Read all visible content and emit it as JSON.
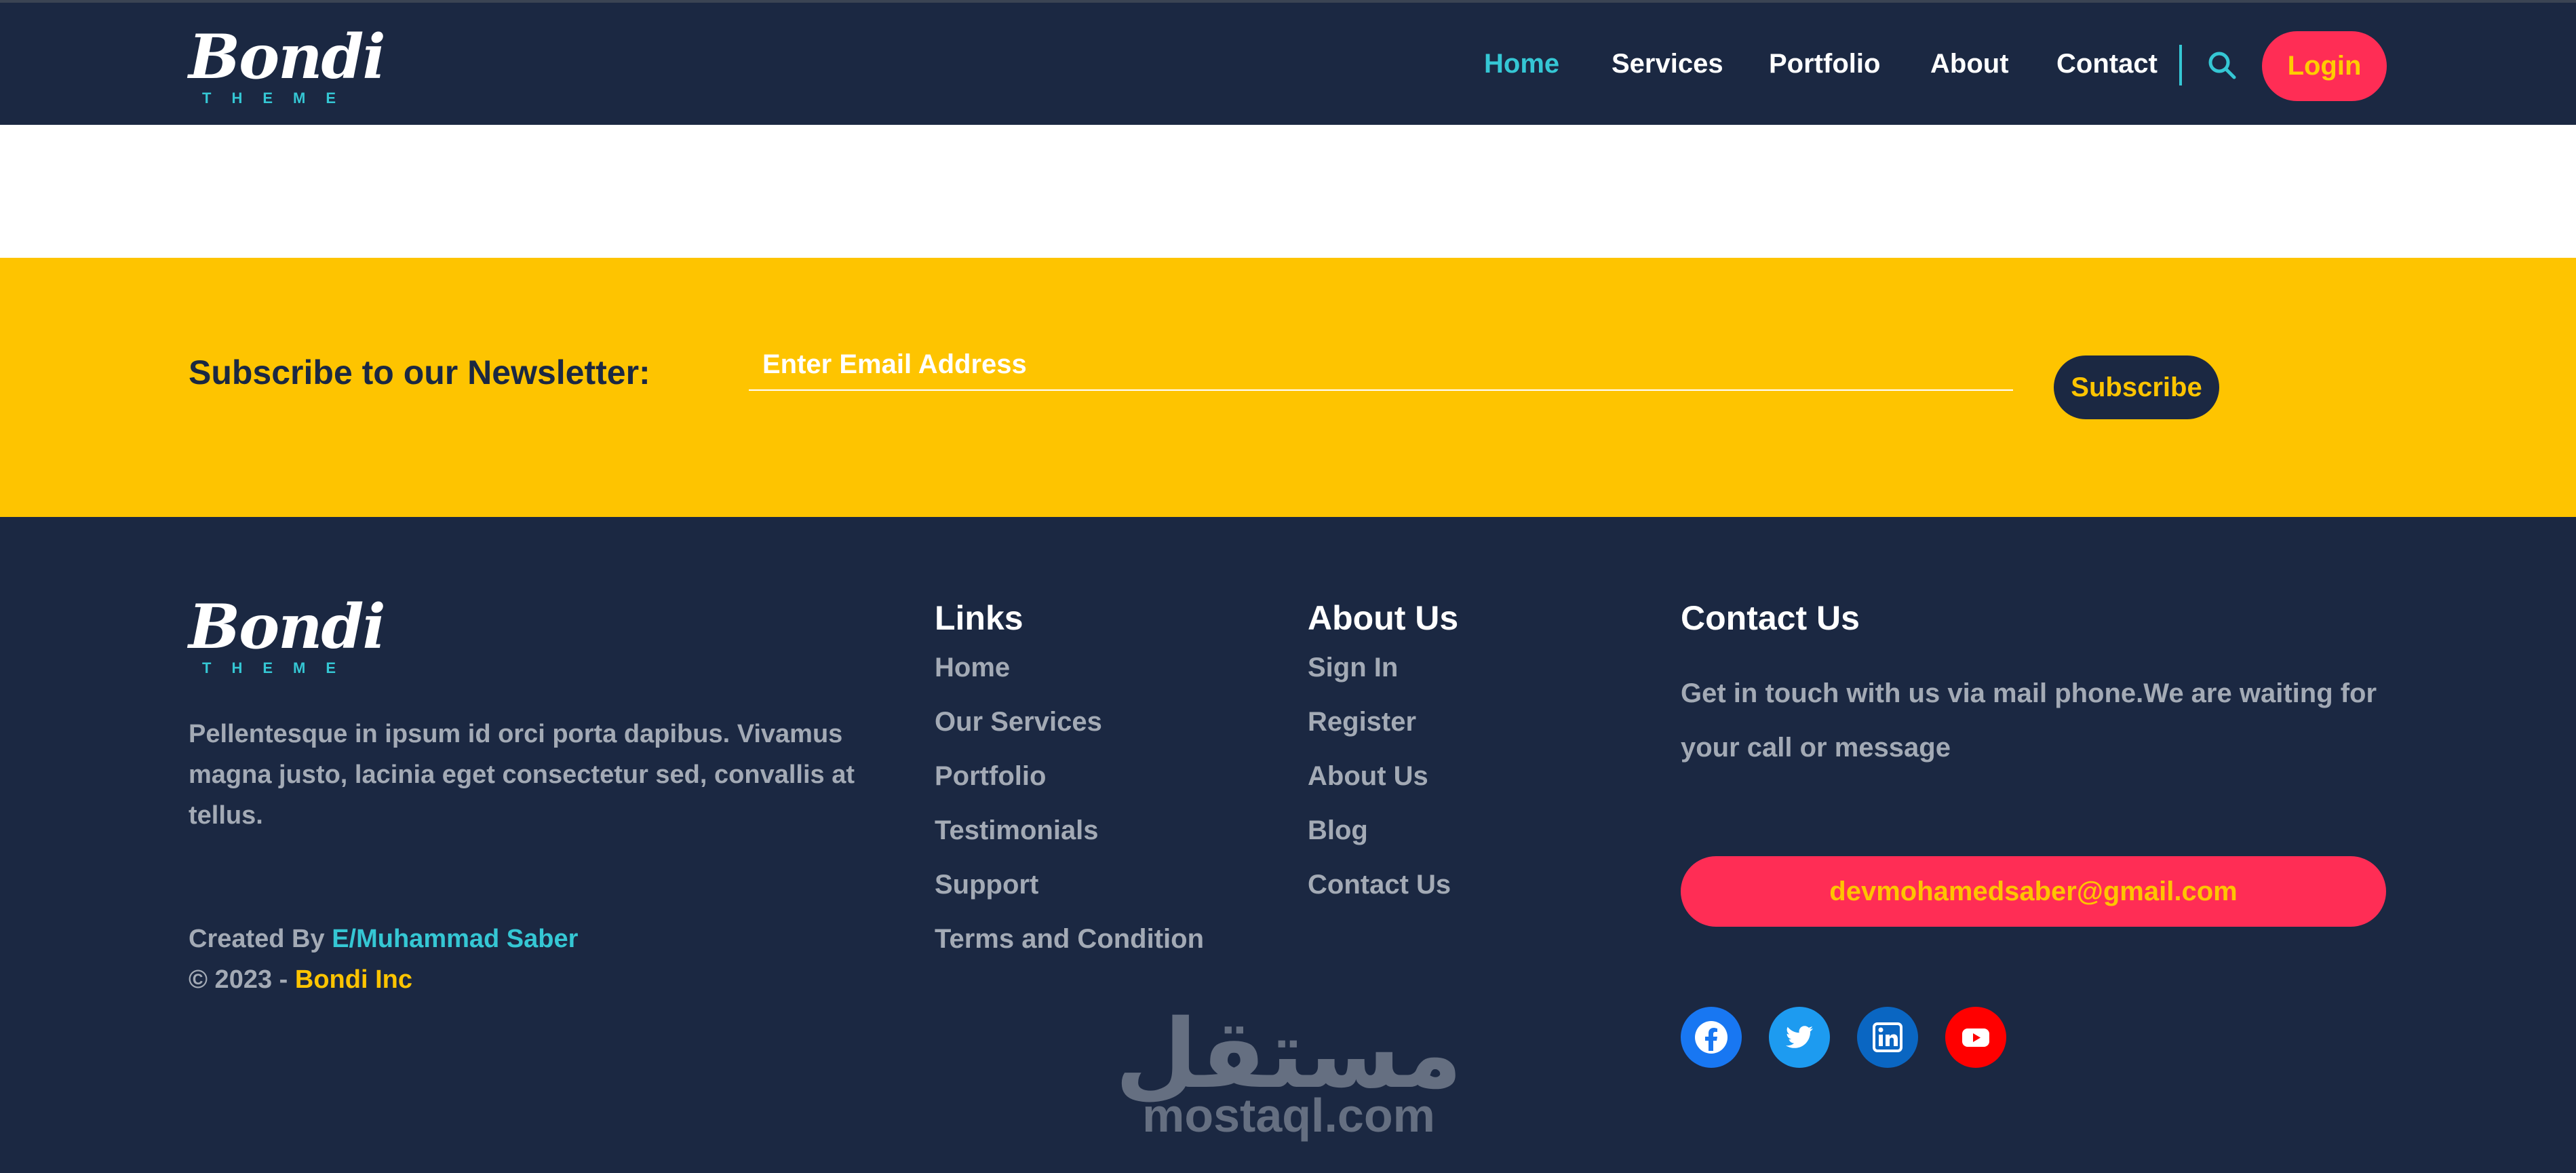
{
  "brand": {
    "name": "Bondi",
    "tagline": "THEME"
  },
  "nav": {
    "items": [
      "Home",
      "Services",
      "Portfolio",
      "About",
      "Contact"
    ],
    "active": "Home",
    "search_icon": "search-icon",
    "login_label": "Login"
  },
  "newsletter": {
    "title": "Subscribe to our Newsletter:",
    "placeholder": "Enter Email Address",
    "value": "",
    "button_label": "Subscribe"
  },
  "footer": {
    "description": "Pellentesque in ipsum id orci porta dapibus. Vivamus magna justo, lacinia eget consectetur sed, convallis at tellus.",
    "created_by_prefix": "Created By ",
    "author": "E/Muhammad Saber",
    "copyright_prefix": "© 2023 - ",
    "company": "Bondi Inc",
    "links": {
      "title": "Links",
      "items": [
        "Home",
        "Our Services",
        "Portfolio",
        "Testimonials",
        "Support",
        "Terms and Condition"
      ]
    },
    "about": {
      "title": "About Us",
      "items": [
        "Sign In",
        "Register",
        "About Us",
        "Blog",
        "Contact Us"
      ]
    },
    "contact": {
      "title": "Contact Us",
      "text": "Get in touch with us via mail phone.We are waiting for your call or message",
      "email": "devmohamedsaber@gmail.com"
    },
    "social": [
      "facebook-icon",
      "twitter-icon",
      "linkedin-icon",
      "youtube-icon"
    ]
  },
  "watermark": {
    "arabic": "مستقل",
    "latin": "mostaql.com"
  },
  "colors": {
    "navy": "#1b2842",
    "teal": "#35c7d4",
    "yellow": "#fec400",
    "pink": "#ff2d55",
    "muted_text": "#a3aab5"
  }
}
